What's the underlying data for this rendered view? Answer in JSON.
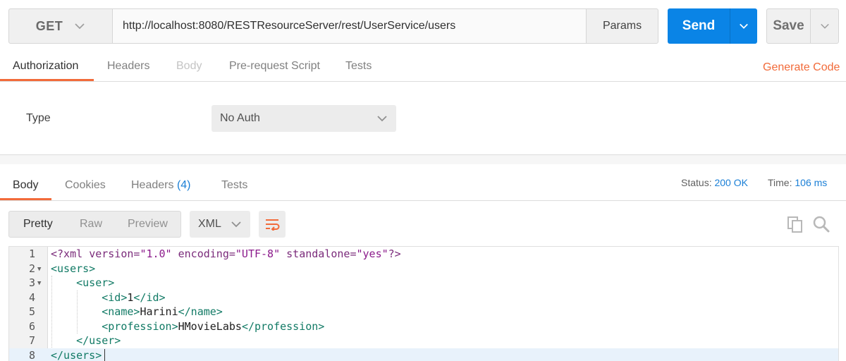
{
  "request": {
    "method": "GET",
    "url": "http://localhost:8080/RESTResourceServer/rest/UserService/users",
    "params_label": "Params",
    "send_label": "Send",
    "save_label": "Save"
  },
  "request_tabs": [
    "Authorization",
    "Headers",
    "Body",
    "Pre-request Script",
    "Tests"
  ],
  "generate_code_label": "Generate Code",
  "auth": {
    "type_label": "Type",
    "type_value": "No Auth"
  },
  "response_tabs": {
    "body": "Body",
    "cookies": "Cookies",
    "headers": "Headers",
    "headers_count": "(4)",
    "tests": "Tests"
  },
  "status": {
    "label": "Status:",
    "value": "200 OK",
    "time_label": "Time:",
    "time_value": "106 ms"
  },
  "viewer": {
    "modes": [
      "Pretty",
      "Raw",
      "Preview"
    ],
    "format": "XML"
  },
  "code": {
    "line_numbers": [
      "1",
      "2",
      "3",
      "4",
      "5",
      "6",
      "7",
      "8"
    ],
    "xml_decl": {
      "open": "<?xml",
      "version_attr": "version=",
      "version_val": "\"1.0\"",
      "encoding_attr": "encoding=",
      "encoding_val": "\"UTF-8\"",
      "standalone_attr": "standalone=",
      "standalone_val": "\"yes\"",
      "close": "?>"
    },
    "users_open": "<users>",
    "user_open": "<user>",
    "id_open": "<id>",
    "id_value": "1",
    "id_close": "</id>",
    "name_open": "<name>",
    "name_value": "Harini",
    "name_close": "</name>",
    "profession_open": "<profession>",
    "profession_value": "HMovieLabs",
    "profession_close": "</profession>",
    "user_close": "</user>",
    "users_close": "</users>"
  },
  "colors": {
    "accent": "#f26b3a",
    "primary": "#0a84e6",
    "link": "#1a7fd6",
    "xml_tag": "#117a65",
    "xml_string": "#8b1a8b"
  },
  "icons": [
    "chevron-down-icon",
    "wrap-lines-icon",
    "copy-icon",
    "search-icon"
  ]
}
